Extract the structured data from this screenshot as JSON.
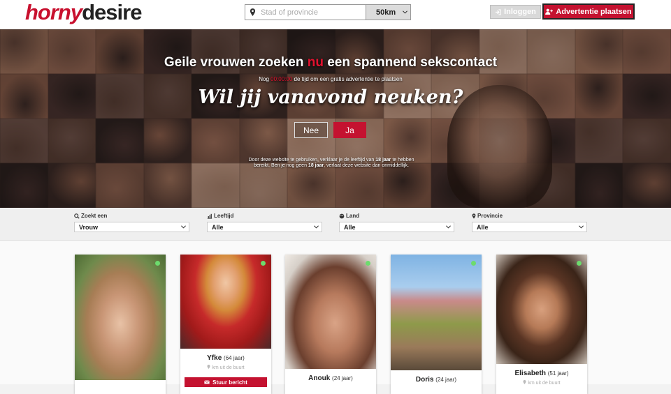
{
  "brand": {
    "logo_a": "horny",
    "logo_b": "desire"
  },
  "search": {
    "placeholder": "Stad of provincie",
    "radius": "50km"
  },
  "header": {
    "login_label": "Inloggen",
    "post_ad_label": "Advertentie plaatsen"
  },
  "hero": {
    "title_pre": "Geile vrouwen zoeken ",
    "title_highlight": "nu",
    "title_post": " een spannend sekscontact",
    "sub_pre": "Nog",
    "sub_timer": "00:00:00",
    "sub_post": "de tijd om een gratis advertentie te plaatsen",
    "question": "Wil jij vanavond neuken?",
    "no_label": "Nee",
    "yes_label": "Ja",
    "disclaimer_1": "Door deze website te gebruiken, verklaar je de leeftijd van ",
    "disclaimer_age": "18 jaar",
    "disclaimer_2": " te hebben bereikt. Ben je nog geen ",
    "disclaimer_age2": "18 jaar",
    "disclaimer_3": ", verlaat deze website dan onmiddellijk."
  },
  "filters": [
    {
      "label": "Zoekt een",
      "value": "Vrouw",
      "icon": "search-icon"
    },
    {
      "label": "Leeftijd",
      "value": "Alle",
      "icon": "bar-chart-icon"
    },
    {
      "label": "Land",
      "value": "Alle",
      "icon": "globe-icon"
    },
    {
      "label": "Provincie",
      "value": "Alle",
      "icon": "map-pin-icon"
    }
  ],
  "profiles": [
    {
      "name": "",
      "age": "",
      "distance": ""
    },
    {
      "name": "Yfke",
      "age": "(64 jaar)",
      "distance": "km uit de buurt",
      "message_label": "Stuur bericht"
    },
    {
      "name": "Anouk",
      "age": "(24 jaar)",
      "distance": ""
    },
    {
      "name": "Doris",
      "age": "(24 jaar)",
      "distance": ""
    },
    {
      "name": "Elisabeth",
      "age": "(51 jaar)",
      "distance": "km uit de buurt"
    }
  ],
  "colors": {
    "accent": "#c41230",
    "online": "#6ddb6d"
  }
}
